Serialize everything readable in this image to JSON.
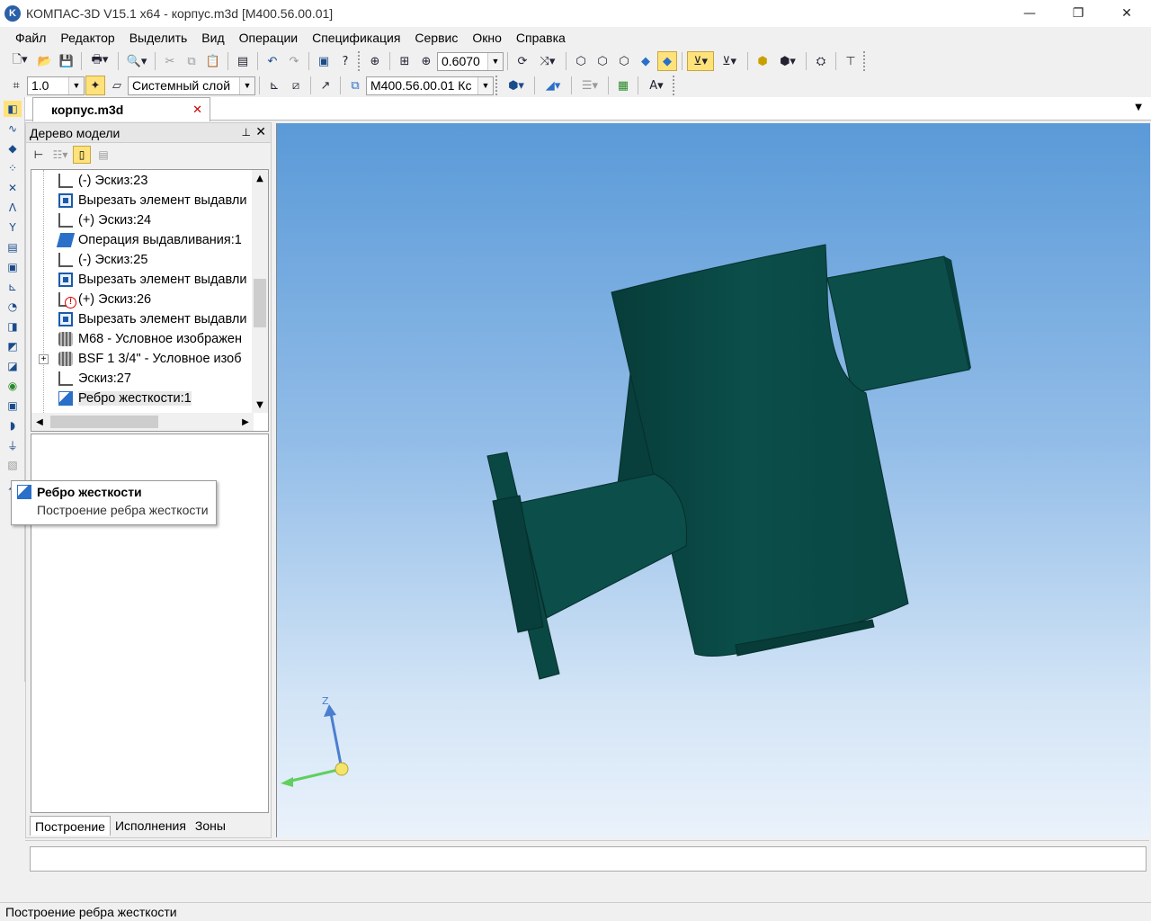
{
  "app": {
    "title": "КОМПАС-3D V15.1 x64 - корпус.m3d [М400.56.00.01]",
    "logo_letter": "K",
    "controls": {
      "minimize": "—",
      "maximize": "❐",
      "close": "✕"
    }
  },
  "menu": [
    "Файл",
    "Редактор",
    "Выделить",
    "Вид",
    "Операции",
    "Спецификация",
    "Сервис",
    "Окно",
    "Справка"
  ],
  "toolbar1": {
    "zoom_value": "0.6070"
  },
  "toolbar2": {
    "step_value": "1.0",
    "layer_value": "Системный слой",
    "designation_value": "М400.56.00.01 Кс"
  },
  "document_tab": {
    "label": "корпус.m3d",
    "close": "✕"
  },
  "model_tree": {
    "title": "Дерево модели",
    "pin": "📌",
    "close": "✕",
    "items": [
      {
        "label": "(-) Эскиз:23",
        "icon": "sketch-icon"
      },
      {
        "label": "Вырезать элемент выдавли",
        "icon": "cut-extrude-icon"
      },
      {
        "label": "(+) Эскиз:24",
        "icon": "sketch-icon"
      },
      {
        "label": "Операция выдавливания:1",
        "icon": "extrude-icon"
      },
      {
        "label": "(-) Эскиз:25",
        "icon": "sketch-icon"
      },
      {
        "label": "Вырезать элемент выдавли",
        "icon": "cut-extrude-icon"
      },
      {
        "label": "(+) Эскиз:26",
        "icon": "sketch-error-icon"
      },
      {
        "label": "Вырезать элемент выдавли",
        "icon": "cut-extrude-icon"
      },
      {
        "label": "М68 - Условное изображен",
        "icon": "thread-icon"
      },
      {
        "label": "BSF 1 3/4\" - Условное изоб",
        "icon": "thread-icon",
        "expander": "+"
      },
      {
        "label": "Эскиз:27",
        "icon": "sketch-icon"
      },
      {
        "label": "Ребро жесткости:1",
        "icon": "rib-icon",
        "selected": true
      }
    ],
    "bottom_tabs": [
      "Построение",
      "Исполнения",
      "Зоны"
    ]
  },
  "tooltip": {
    "title": "Ребро жесткости",
    "description": "Построение ребра жесткости"
  },
  "axes": {
    "z_label": "Z"
  },
  "status_bar": {
    "text": "Построение ребра жесткости"
  },
  "colors": {
    "model_fill": "#0b4e4a",
    "model_dark": "#073c39",
    "viewport_top": "#5a9ad8",
    "viewport_bottom": "#eaf2fb",
    "accent_active": "#ffe27a"
  }
}
